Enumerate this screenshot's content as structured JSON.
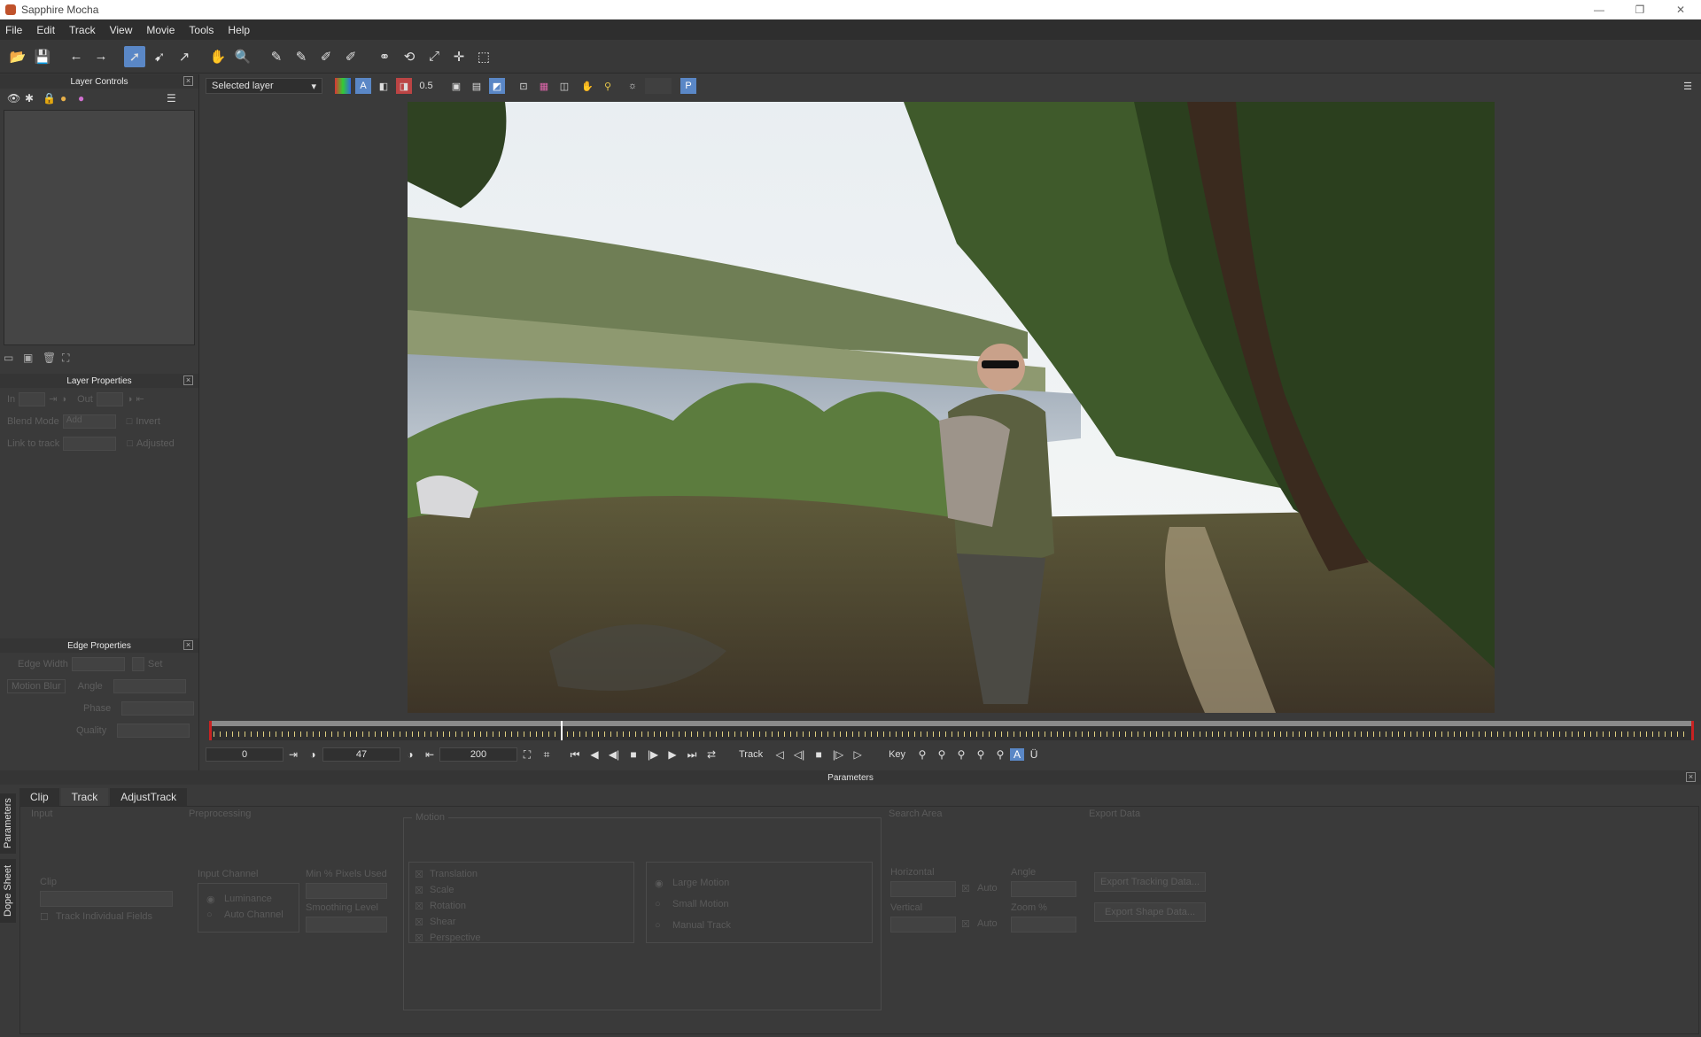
{
  "window": {
    "title": "Sapphire Mocha",
    "minimize": "—",
    "restore": "❐",
    "close": "✕"
  },
  "menu": [
    "File",
    "Edit",
    "Track",
    "View",
    "Movie",
    "Tools",
    "Help"
  ],
  "left": {
    "layer_controls_title": "Layer Controls",
    "layer_properties_title": "Layer Properties",
    "in_label": "In",
    "out_label": "Out",
    "blend_mode_label": "Blend Mode",
    "blend_mode_value": "Add",
    "invert_label": "Invert",
    "link_to_track_label": "Link to track",
    "adjusted_label": "Adjusted",
    "edge_properties_title": "Edge Properties",
    "edge_width_label": "Edge Width",
    "set_label": "Set",
    "motion_blur_label": "Motion Blur",
    "angle_label": "Angle",
    "phase_label": "Phase",
    "quality_label": "Quality"
  },
  "viewer": {
    "layer_select": "Selected layer",
    "opacity_value": "0.5",
    "p_button": "P"
  },
  "transport": {
    "in_frame": "0",
    "current_frame": "47",
    "out_frame": "200",
    "track_label": "Track",
    "key_label": "Key"
  },
  "params": {
    "title": "Parameters",
    "side_tabs": [
      "Parameters",
      "Dope Sheet"
    ],
    "tabs": [
      "Clip",
      "Track",
      "AdjustTrack"
    ],
    "active_tab": "Track",
    "input_label": "Input",
    "clip_label": "Clip",
    "track_individual_fields": "Track Individual Fields",
    "preprocessing_label": "Preprocessing",
    "input_channel_label": "Input Channel",
    "luminance": "Luminance",
    "auto_channel": "Auto Channel",
    "min_pixels_label": "Min % Pixels Used",
    "smoothing_label": "Smoothing Level",
    "motion_label": "Motion",
    "motions": [
      "Translation",
      "Scale",
      "Rotation",
      "Shear",
      "Perspective"
    ],
    "large_motion": "Large Motion",
    "small_motion": "Small Motion",
    "manual_track": "Manual Track",
    "search_area_label": "Search Area",
    "horizontal_label": "Horizontal",
    "vertical_label": "Vertical",
    "auto_label": "Auto",
    "angle_label": "Angle",
    "zoom_label": "Zoom %",
    "export_data_label": "Export Data",
    "export_tracking": "Export Tracking Data...",
    "export_shape": "Export Shape Data..."
  },
  "colors": {
    "accent": "#5a87c6",
    "timeline_bound": "#c82222"
  }
}
